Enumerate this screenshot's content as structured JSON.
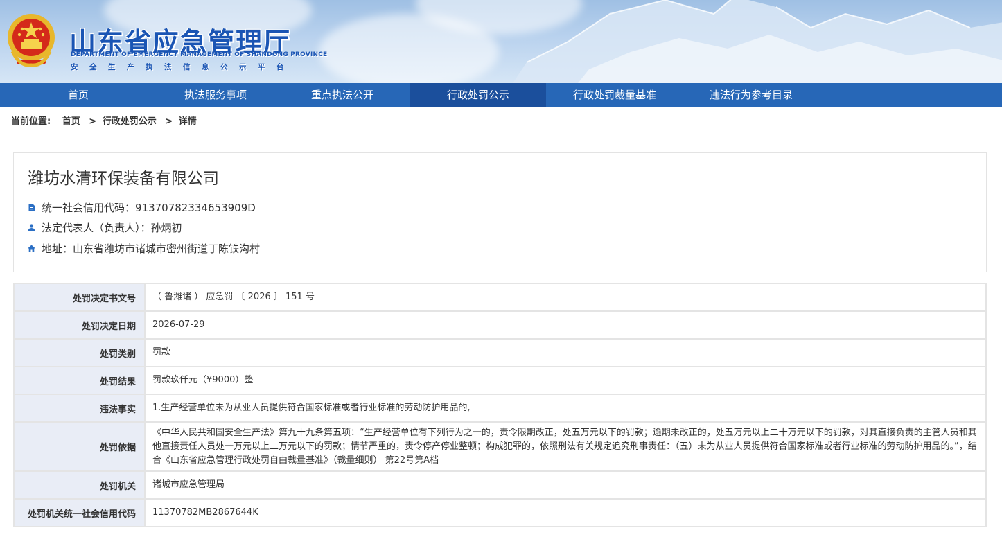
{
  "header": {
    "title": "山东省应急管理厅",
    "subtitle_en": "DEPARTMENT OF EMERGENCY MANAGEMENT OF SHANDONG PROVINCE",
    "subtitle_cn": "安全生产执法信息公示平台"
  },
  "nav": {
    "items": [
      {
        "label": "首页"
      },
      {
        "label": "执法服务事项"
      },
      {
        "label": "重点执法公开"
      },
      {
        "label": "行政处罚公示",
        "active": true
      },
      {
        "label": "行政处罚裁量基准"
      },
      {
        "label": "违法行为参考目录"
      }
    ]
  },
  "breadcrumb": {
    "prefix": "当前位置:",
    "items": [
      "首页",
      "行政处罚公示",
      "详情"
    ],
    "separator": ">"
  },
  "company": {
    "name": "潍坊水清环保装备有限公司",
    "credit_code": "统一社会信用代码：91370782334653909D",
    "legal_rep": "法定代表人（负责人）：孙炳初",
    "address": "地址：山东省潍坊市诸城市密州街道丁陈铁沟村"
  },
  "details": [
    {
      "label": "处罚决定书文号",
      "value": "（ 鲁潍诸 ） 应急罚 〔 2026 〕 151 号"
    },
    {
      "label": "处罚决定日期",
      "value": "2026-07-29"
    },
    {
      "label": "处罚类别",
      "value": "罚款"
    },
    {
      "label": "处罚结果",
      "value": "罚款玖仟元（¥9000）整"
    },
    {
      "label": "违法事实",
      "value": "1.生产经营单位未为从业人员提供符合国家标准或者行业标准的劳动防护用品的,"
    },
    {
      "label": "处罚依据",
      "value": "《中华人民共和国安全生产法》第九十九条第五项：“生产经营单位有下列行为之一的，责令限期改正，处五万元以下的罚款；逾期未改正的，处五万元以上二十万元以下的罚款，对其直接负责的主管人员和其他直接责任人员处一万元以上二万元以下的罚款；情节严重的，责令停产停业整顿；构成犯罪的，依照刑法有关规定追究刑事责任：（五）未为从业人员提供符合国家标准或者行业标准的劳动防护用品的。”，结合《山东省应急管理行政处罚自由裁量基准》（裁量细则） 第22号第A档"
    },
    {
      "label": "处罚机关",
      "value": "诸城市应急管理局"
    },
    {
      "label": "处罚机关统一社会信用代码",
      "value": "11370782MB2867644K"
    }
  ],
  "colors": {
    "nav_bg": "#2767b7",
    "nav_active": "#1b4f9c",
    "title_blue": "#1a55b4",
    "label_bg": "#e9edf6",
    "icon_blue": "#2b6fc4"
  },
  "icons": {
    "credit_code": "document-icon",
    "legal_rep": "person-icon",
    "address": "home-icon"
  }
}
